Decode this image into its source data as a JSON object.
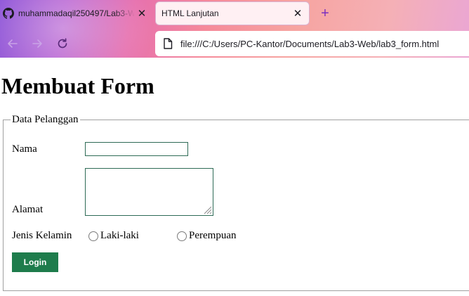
{
  "browser": {
    "tabs": [
      {
        "title": "muhammadaqil250497/Lab3-Web",
        "active": false,
        "favicon": "github-icon"
      },
      {
        "title": "HTML Lanjutan",
        "active": true
      }
    ],
    "new_tab_label": "+",
    "close_label": "✕",
    "url": "file:///C:/Users/PC-Kantor/Documents/Lab3-Web/lab3_form.html"
  },
  "page": {
    "heading": "Membuat Form",
    "fieldset_legend": "Data Pelanggan",
    "form": {
      "nama_label": "Nama",
      "nama_value": "",
      "alamat_label": "Alamat",
      "alamat_value": "",
      "jenis_kelamin_label": "Jenis Kelamin",
      "gender_options": [
        "Laki-laki",
        "Perempuan"
      ],
      "submit_label": "Login"
    }
  },
  "colors": {
    "button_bg": "#1e7c4c",
    "input_border": "#2e6b56",
    "new_tab_accent": "#7b2fbf"
  }
}
